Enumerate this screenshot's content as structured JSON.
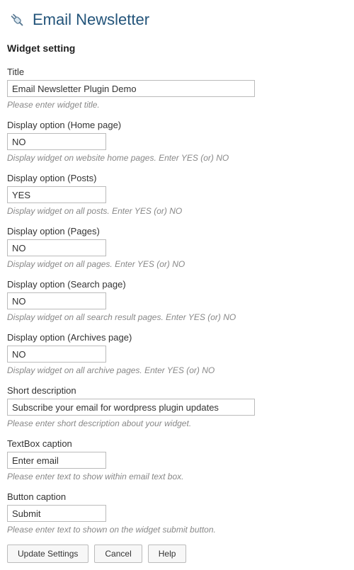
{
  "header": {
    "title": "Email Newsletter"
  },
  "section_heading": "Widget setting",
  "fields": {
    "title": {
      "label": "Title",
      "value": "Email Newsletter Plugin Demo",
      "help": "Please enter widget title."
    },
    "home": {
      "label": "Display option (Home page)",
      "value": "NO",
      "help": "Display widget on website home pages. Enter YES (or) NO"
    },
    "posts": {
      "label": "Display option (Posts)",
      "value": "YES",
      "help": "Display widget on all posts. Enter YES (or) NO"
    },
    "pages": {
      "label": "Display option (Pages)",
      "value": "NO",
      "help": "Display widget on all pages. Enter YES (or) NO"
    },
    "search": {
      "label": "Display option (Search page)",
      "value": "NO",
      "help": "Display widget on all search result pages. Enter YES (or) NO"
    },
    "archives": {
      "label": "Display option (Archives page)",
      "value": "NO",
      "help": "Display widget on all archive pages. Enter YES (or) NO"
    },
    "short_desc": {
      "label": "Short description",
      "value": "Subscribe your email for wordpress plugin updates",
      "help": "Please enter short description about your widget."
    },
    "textbox_caption": {
      "label": "TextBox caption",
      "value": "Enter email",
      "help": "Please enter text to show within email text box."
    },
    "button_caption": {
      "label": "Button caption",
      "value": "Submit",
      "help": "Please enter text to shown on the widget submit button."
    }
  },
  "buttons": {
    "update": "Update Settings",
    "cancel": "Cancel",
    "help": "Help"
  }
}
